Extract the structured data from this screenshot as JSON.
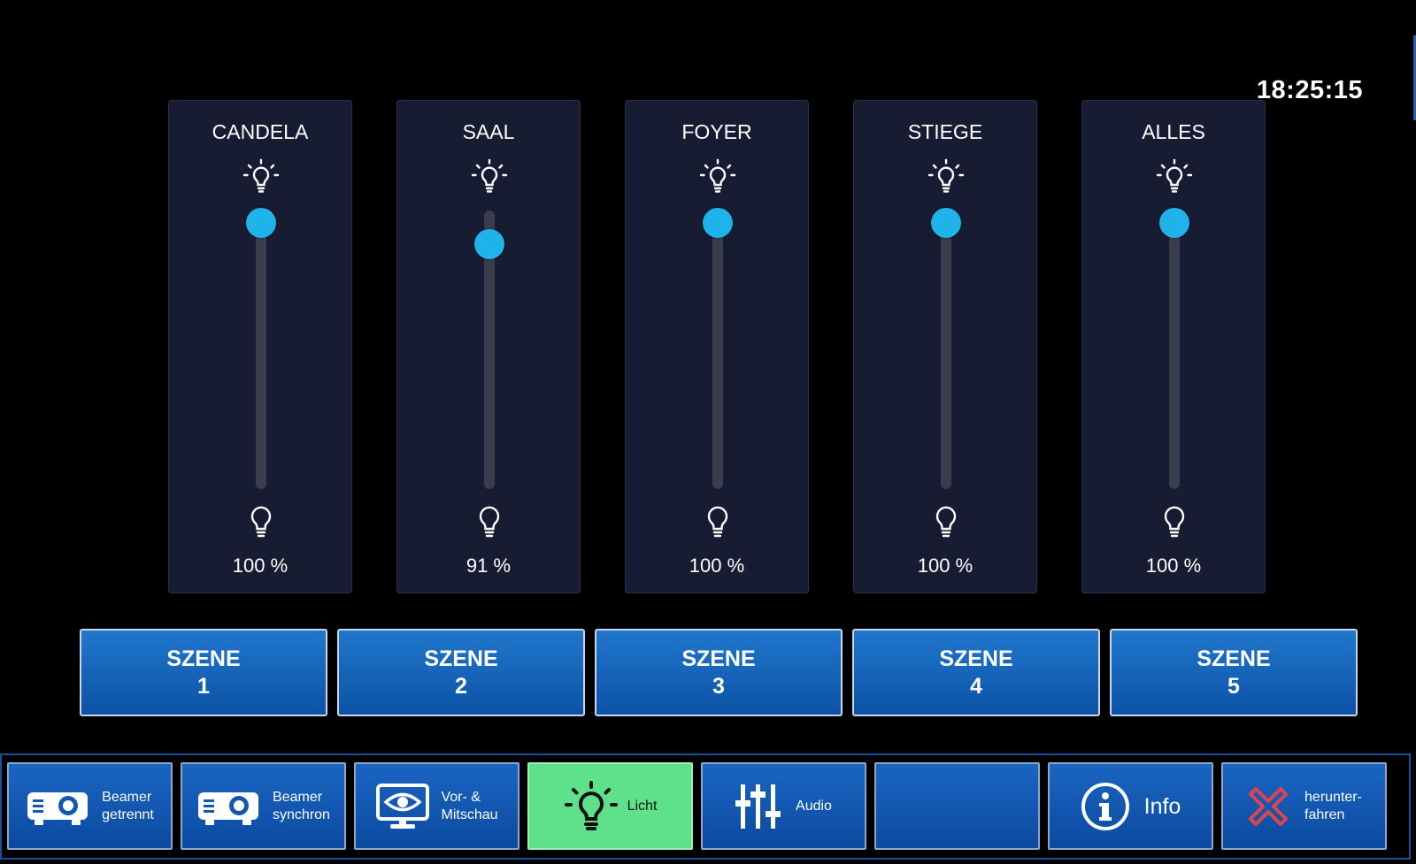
{
  "clock": "18:25:15",
  "lights": [
    {
      "name": "CANDELA",
      "value_text": "100 %",
      "level_percent": 100
    },
    {
      "name": "SAAL",
      "value_text": "91 %",
      "level_percent": 91
    },
    {
      "name": "FOYER",
      "value_text": "100 %",
      "level_percent": 100
    },
    {
      "name": "STIEGE",
      "value_text": "100 %",
      "level_percent": 100
    },
    {
      "name": "ALLES",
      "value_text": "100 %",
      "level_percent": 100
    }
  ],
  "scenes": [
    {
      "line1": "SZENE",
      "line2": "1"
    },
    {
      "line1": "SZENE",
      "line2": "2"
    },
    {
      "line1": "SZENE",
      "line2": "3"
    },
    {
      "line1": "SZENE",
      "line2": "4"
    },
    {
      "line1": "SZENE",
      "line2": "5"
    }
  ],
  "nav": [
    {
      "line1": "Beamer",
      "line2": "getrennt",
      "icon": "projector-icon"
    },
    {
      "line1": "Beamer",
      "line2": "synchron",
      "icon": "projector-icon"
    },
    {
      "line1": "Vor- &",
      "line2": "Mitschau",
      "icon": "monitor-eye-icon"
    },
    {
      "line1": "Licht",
      "icon": "light-bulb-icon",
      "active": true
    },
    {
      "line1": "Audio",
      "icon": "mixer-sliders-icon"
    },
    {
      "line1": "",
      "icon": ""
    },
    {
      "line1": "Info",
      "icon": "info-icon"
    },
    {
      "line1": "herunter-",
      "line2": "fahren",
      "icon": "shutdown-x-icon"
    }
  ],
  "colors": {
    "slider_knob": "#1fb3ea",
    "panel_bg": "#181c33",
    "button_blue": "#1565c0",
    "active_green": "#5fe08a",
    "shutdown_red": "#e0434b"
  }
}
